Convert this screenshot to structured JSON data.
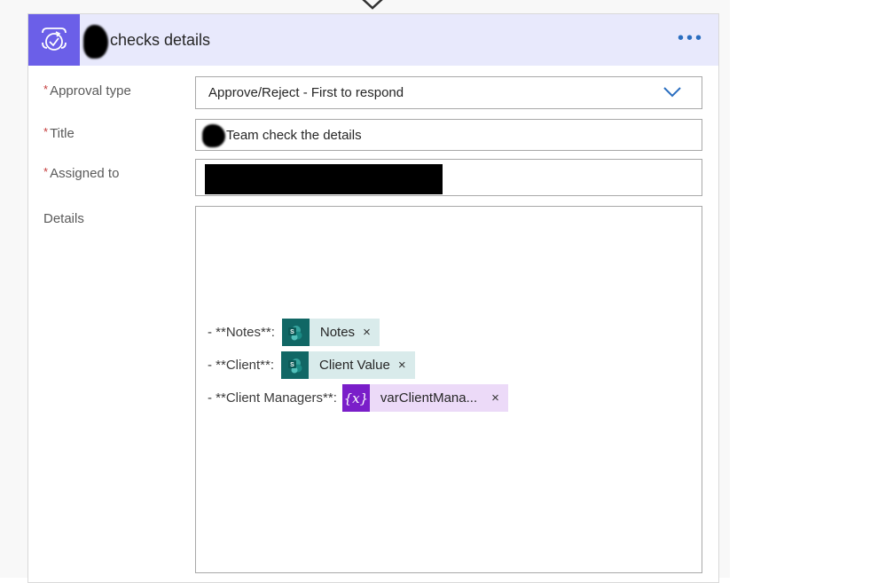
{
  "flow": {
    "connector_icon": "chevron-down-arrow"
  },
  "action": {
    "title": "checks details",
    "icon": "approval-icon",
    "more_label": "•••",
    "theme_color": "#6b5fe8"
  },
  "fields": {
    "approval_type": {
      "label": "Approval type",
      "required_mark": "*",
      "value": "Approve/Reject - First to respond"
    },
    "title": {
      "label": "Title",
      "required_mark": "*",
      "value": "Team check the details"
    },
    "assigned_to": {
      "label": "Assigned to",
      "required_mark": "*",
      "value": ""
    },
    "details": {
      "label": "Details",
      "lines": [
        {
          "prefix": "- **Notes**:",
          "token": {
            "type": "sharepoint",
            "icon": "sharepoint-icon",
            "label": "Notes",
            "remove": "×"
          }
        },
        {
          "prefix": "- **Client**:",
          "token": {
            "type": "sharepoint",
            "icon": "sharepoint-icon",
            "label": "Client Value",
            "remove": "×"
          }
        },
        {
          "prefix": "- **Client Managers**:",
          "token": {
            "type": "variable",
            "icon": "{x}",
            "label": "varClientMana...",
            "remove": "×"
          }
        }
      ]
    }
  }
}
